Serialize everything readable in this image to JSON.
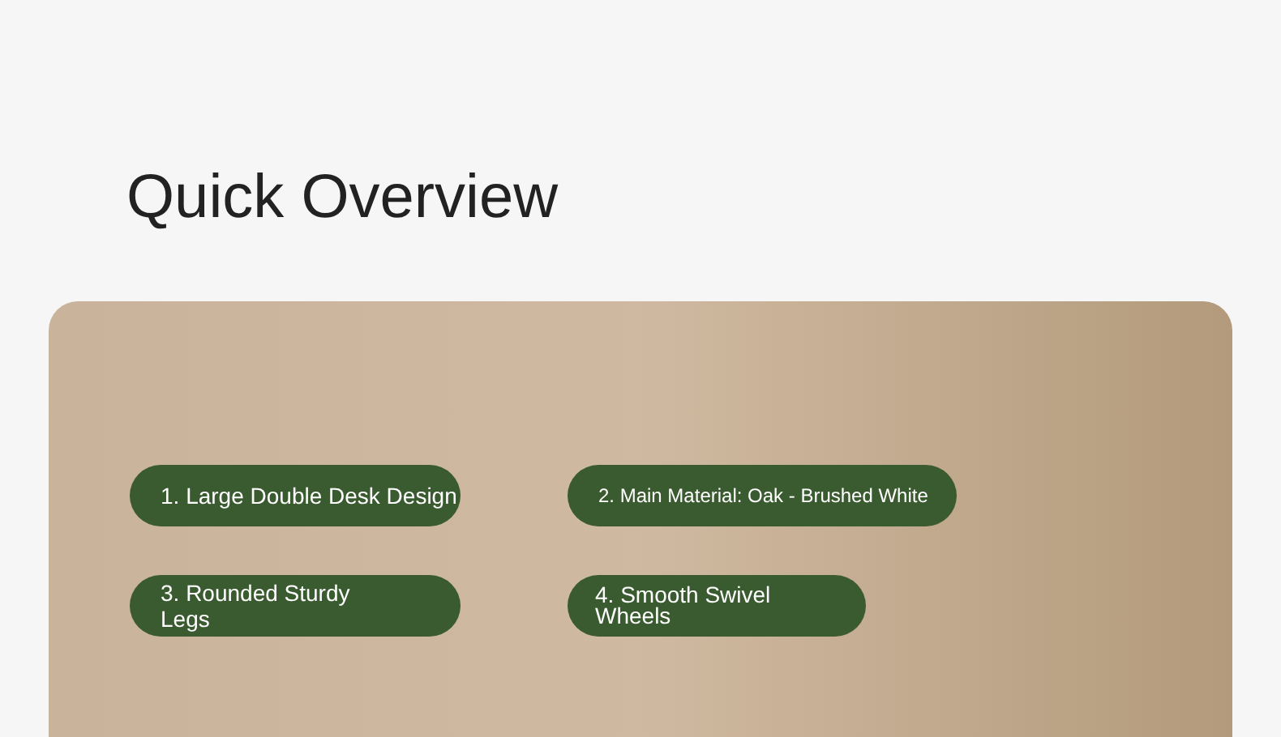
{
  "heading": "Quick Overview",
  "features": [
    {
      "label": "1. Large Double Desk Design"
    },
    {
      "label": "2. Main Material: Oak - Brushed White"
    },
    {
      "label": "3. Rounded Sturdy Legs"
    },
    {
      "label": "4. Smooth Swivel Wheels"
    }
  ]
}
